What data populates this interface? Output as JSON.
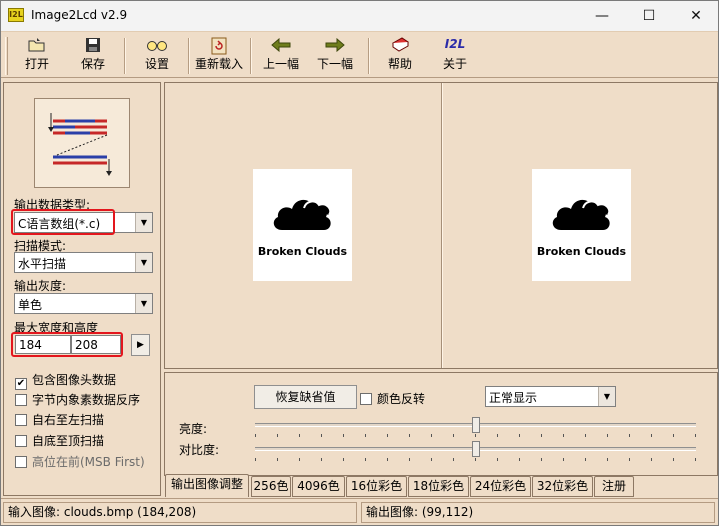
{
  "window": {
    "app_icon_text": "I2L",
    "title": "Image2Lcd v2.9",
    "minimize_glyph": "—",
    "maximize_glyph": "☐",
    "close_glyph": "✕"
  },
  "toolbar": {
    "open": "打开",
    "save": "保存",
    "settings": "设置",
    "reload": "重新载入",
    "prev": "上一幅",
    "next": "下一幅",
    "help": "帮助",
    "about": "关于",
    "about_icon_text": "I2L"
  },
  "left_panel": {
    "output_type_label": "输出数据类型:",
    "output_type_value": "C语言数组(*.c)",
    "scan_mode_label": "扫描模式:",
    "scan_mode_value": "水平扫描",
    "gray_label": "输出灰度:",
    "gray_value": "单色",
    "size_label": "最大宽度和高度",
    "width_value": "184",
    "height_value": "208",
    "size_apply_glyph": "▶",
    "options": [
      {
        "label": "包含图像头数据",
        "checked": true
      },
      {
        "label": "字节内象素数据反序",
        "checked": false
      },
      {
        "label": "自右至左扫描",
        "checked": false
      },
      {
        "label": "自底至顶扫描",
        "checked": false
      },
      {
        "label": "高位在前(MSB First)",
        "checked": false
      }
    ]
  },
  "preview": {
    "left_caption": "Broken Clouds",
    "right_caption": "Broken Clouds"
  },
  "adjust": {
    "restore_default_button": "恢复缺省值",
    "invert_color_label": "颜色反转",
    "display_mode_value": "正常显示",
    "brightness_label": "亮度:",
    "contrast_label": "对比度:",
    "brightness_level": 0.5,
    "contrast_level": 0.5
  },
  "tabs": [
    "输出图像调整",
    "256色",
    "4096色",
    "16位彩色",
    "18位彩色",
    "24位彩色",
    "32位彩色",
    "注册"
  ],
  "status": {
    "input_image": "输入图像: clouds.bmp (184,208)",
    "output_image": "输出图像: (99,112)"
  },
  "colors": {
    "panel_bg": "#efddc8",
    "highlight_border": "#e3161d"
  }
}
